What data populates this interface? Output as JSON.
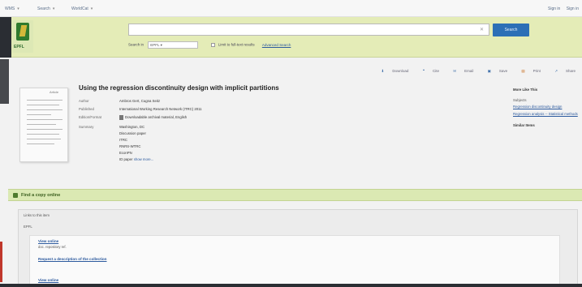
{
  "topnav": {
    "menus": [
      "WMS",
      "Search",
      "WorldCat"
    ],
    "right_links": [
      "Sign in",
      "Sign in"
    ]
  },
  "header": {
    "logo_text": "EPFL",
    "search_placeholder": "",
    "search_button": "Search",
    "search_in_label": "Search in",
    "search_in_value": "EPFL",
    "limit_label": "Limit to full-text results",
    "advanced_link": "Advanced Search"
  },
  "toolbar": {
    "items": [
      {
        "icon": "download-icon",
        "label": "Download"
      },
      {
        "icon": "cite-icon",
        "label": "Cite"
      },
      {
        "icon": "email-icon",
        "label": "Email"
      },
      {
        "icon": "save-icon",
        "label": "Save"
      },
      {
        "icon": "print-icon",
        "label": "Print"
      },
      {
        "icon": "share-icon",
        "label": "Share"
      }
    ]
  },
  "record": {
    "title": "Using the regression discontinuity design with implicit partitions",
    "thumb_label": "Article",
    "fields": [
      {
        "key": "Author",
        "value": "Ambros Gert, Cugna Seitz"
      },
      {
        "key": "Published",
        "value": "International Working Research Network (ITRC) 2011"
      },
      {
        "key": "Edition/Format",
        "value": "Downloadable archival material, English"
      },
      {
        "key": "Summary",
        "value": "Washington, DC"
      },
      {
        "key": "",
        "value": "Discussion paper"
      },
      {
        "key": "",
        "value": "ITRC"
      },
      {
        "key": "",
        "value": "RNRS-WTRC"
      },
      {
        "key": "",
        "value": "EconPN"
      },
      {
        "key": "",
        "value": "ID paper",
        "link": "show more..."
      }
    ]
  },
  "sidebar": {
    "heading": "More Like This",
    "subjects_label": "Subjects",
    "links": [
      "Regression discontinuity design",
      "Regression analysis -- Statistical methods"
    ],
    "more_label": "Similar Items"
  },
  "find_copy": {
    "title": "Find a copy online",
    "links_heading": "Links to this item",
    "library": "EPFL",
    "entries": [
      {
        "name": "View online",
        "desc": "doc. repository ref."
      },
      {
        "name": "Request a description of the collection",
        "desc": ""
      },
      {
        "name": "View online",
        "desc": ""
      }
    ]
  }
}
